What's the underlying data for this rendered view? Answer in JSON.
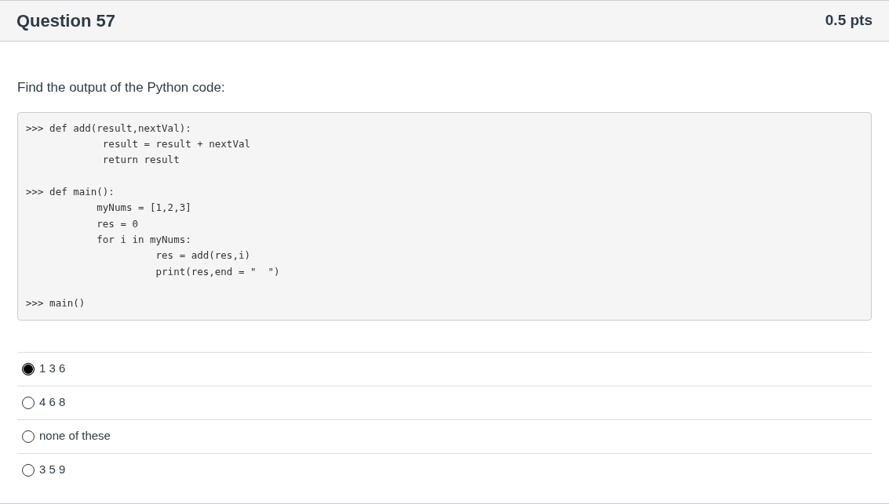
{
  "question": {
    "title": "Question 57",
    "points": "0.5 pts"
  },
  "prompt": "Find the output of the Python code:",
  "code_blocks": [
    [
      ">>> def add(result,nextVal):",
      "             result = result + nextVal",
      "             return result"
    ],
    [
      ">>> def main():",
      "            myNums = [1,2,3]",
      "            res = 0",
      "            for i in myNums:",
      "                      res = add(res,i)",
      "                      print(res,end = \"  \")"
    ],
    [
      ">>> main()"
    ]
  ],
  "answers": [
    {
      "label": "1 3 6",
      "selected": true
    },
    {
      "label": "4 6 8",
      "selected": false
    },
    {
      "label": "none of these",
      "selected": false
    },
    {
      "label": "3 5 9",
      "selected": false
    }
  ]
}
